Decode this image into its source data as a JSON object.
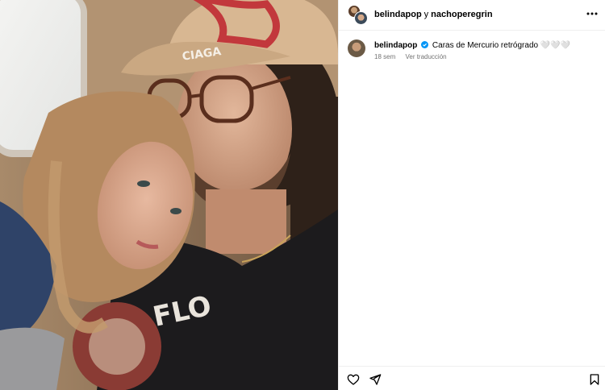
{
  "header": {
    "user1": "belindapop",
    "joiner": "y",
    "user2": "nachoperegrin",
    "more_icon": "more-horizontal-icon"
  },
  "caption": {
    "username": "belindapop",
    "verified_icon": "verified-badge-icon",
    "text": "Caras de Mercurio retrógrado 🤍🤍🤍",
    "time": "18 sem",
    "translate": "Ver traducción"
  },
  "actions": {
    "like_icon": "heart-icon",
    "share_icon": "paper-plane-icon",
    "save_icon": "bookmark-icon"
  },
  "colors": {
    "verified": "#0095f6",
    "muted_text": "#737373",
    "divider": "#efefef"
  }
}
